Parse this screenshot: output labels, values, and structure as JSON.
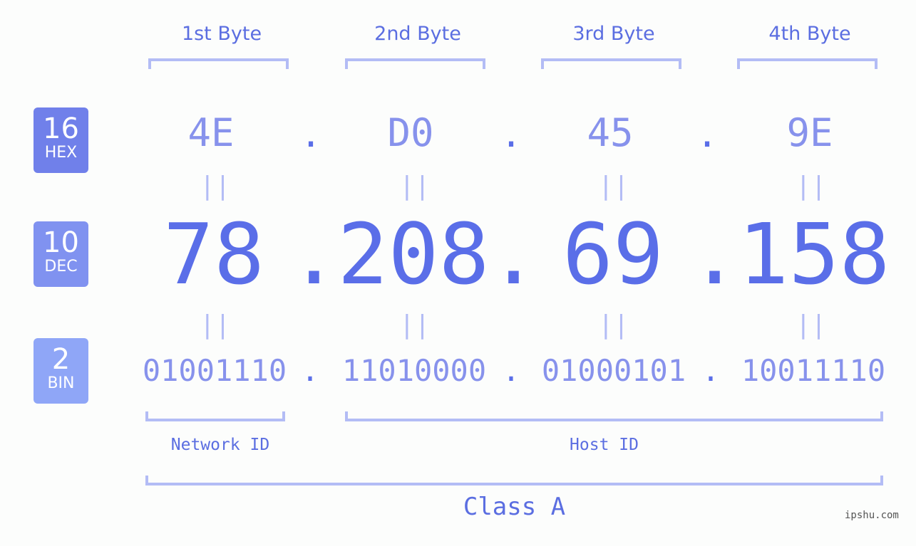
{
  "bytes": [
    {
      "label": "1st Byte",
      "hex": "4E",
      "dec": "78",
      "bin": "01001110"
    },
    {
      "label": "2nd Byte",
      "hex": "D0",
      "dec": "208",
      "bin": "11010000"
    },
    {
      "label": "3rd Byte",
      "hex": "45",
      "dec": "69",
      "bin": "01000101"
    },
    {
      "label": "4th Byte",
      "hex": "9E",
      "dec": "158",
      "bin": "10011110"
    }
  ],
  "separator": ".",
  "equals": "||",
  "bases": [
    {
      "num": "16",
      "name": "HEX",
      "color": "#7080ea"
    },
    {
      "num": "10",
      "name": "DEC",
      "color": "#8092f0"
    },
    {
      "num": "2",
      "name": "BIN",
      "color": "#8fa6f7"
    }
  ],
  "network_id_label": "Network ID",
  "host_id_label": "Host ID",
  "class_label": "Class A",
  "watermark": "ipshu.com",
  "colors": {
    "primary": "#5a6ee8",
    "secondary": "#8792ec",
    "bracket": "#b3bcf5"
  }
}
